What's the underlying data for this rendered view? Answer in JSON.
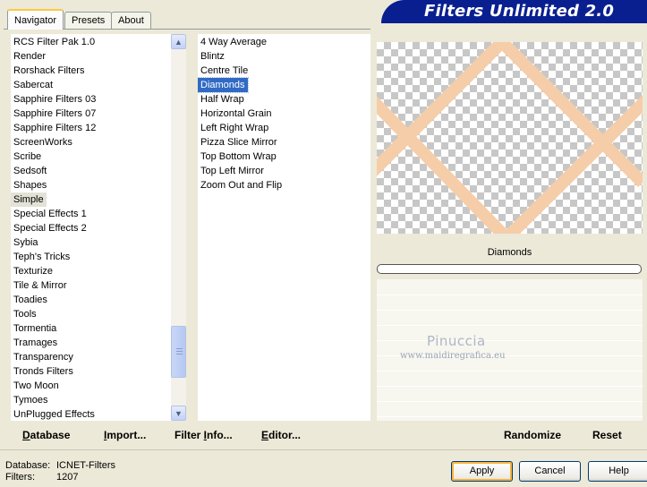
{
  "tabs": [
    "Navigator",
    "Presets",
    "About"
  ],
  "app_title": "Filters Unlimited 2.0",
  "categories": [
    "RCS Filter Pak 1.0",
    "Render",
    "Rorshack Filters",
    "Sabercat",
    "Sapphire Filters 03",
    "Sapphire Filters 07",
    "Sapphire Filters 12",
    "ScreenWorks",
    "Scribe",
    "Sedsoft",
    "Shapes",
    "Simple",
    "Special Effects 1",
    "Special Effects 2",
    "Sybia",
    "Teph's Tricks",
    "Texturize",
    "Tile & Mirror",
    "Toadies",
    "Tools",
    "Tormentia",
    "Tramages",
    "Transparency",
    "Tronds Filters",
    "Two Moon",
    "Tymoes",
    "UnPlugged Effects"
  ],
  "selected_category": "Simple",
  "filters": [
    "4 Way Average",
    "Blintz",
    "Centre Tile",
    "Diamonds",
    "Half Wrap",
    "Horizontal Grain",
    "Left Right Wrap",
    "Pizza Slice Mirror",
    "Top Bottom Wrap",
    "Top Left Mirror",
    "Zoom Out and Flip"
  ],
  "selected_filter": "Diamonds",
  "preview_filter_name": "Diamonds",
  "progress_percent": 0,
  "watermark": {
    "line1": "Pinuccia",
    "line2": "www.maidiregrafica.eu"
  },
  "toolbar": {
    "database": {
      "u": "D",
      "rest": "atabase"
    },
    "import": {
      "u": "I",
      "rest": "mport..."
    },
    "filter_info": {
      "pre": "Filter ",
      "u": "I",
      "rest": "nfo..."
    },
    "editor": {
      "u": "E",
      "rest": "ditor..."
    },
    "randomize": "Randomize",
    "reset": "Reset"
  },
  "info": {
    "database_label": "Database:",
    "database_value": "ICNET-Filters",
    "filters_label": "Filters:",
    "filters_value": "1207"
  },
  "buttons": {
    "apply": "Apply",
    "cancel": "Cancel",
    "help": "Help"
  },
  "colors": {
    "accent": "#316ac5",
    "banner": "#0a1f8f",
    "diamond_lines": "#f5cda9"
  }
}
